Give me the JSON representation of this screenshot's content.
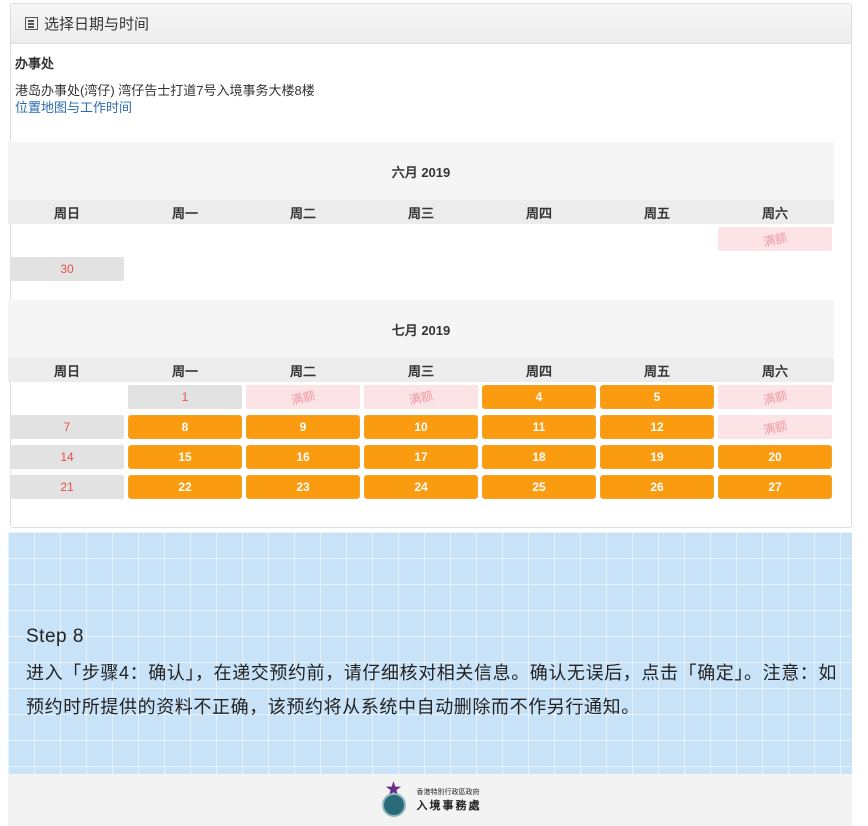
{
  "header": {
    "title": "选择日期与时间",
    "icon": "calendar-list-icon"
  },
  "office": {
    "label": "办事处",
    "address": "港岛办事处(湾仔) 湾仔告士打道7号入境事务大楼8楼",
    "link": "位置地图与工作时间"
  },
  "weekdays": [
    "周日",
    "周一",
    "周二",
    "周三",
    "周四",
    "周五",
    "周六"
  ],
  "months": [
    {
      "title": "六月 2019",
      "weeks": [
        [
          {
            "t": "",
            "s": "empty"
          },
          {
            "t": "",
            "s": "empty"
          },
          {
            "t": "",
            "s": "empty"
          },
          {
            "t": "",
            "s": "empty"
          },
          {
            "t": "",
            "s": "empty"
          },
          {
            "t": "",
            "s": "empty"
          },
          {
            "t": "满额",
            "s": "full"
          }
        ],
        [
          {
            "t": "30",
            "s": "sun"
          },
          {
            "t": "",
            "s": "empty"
          },
          {
            "t": "",
            "s": "empty"
          },
          {
            "t": "",
            "s": "empty"
          },
          {
            "t": "",
            "s": "empty"
          },
          {
            "t": "",
            "s": "empty"
          },
          {
            "t": "",
            "s": "empty"
          }
        ]
      ]
    },
    {
      "title": "七月 2019",
      "weeks": [
        [
          {
            "t": "",
            "s": "empty"
          },
          {
            "t": "1",
            "s": "past"
          },
          {
            "t": "满额",
            "s": "full"
          },
          {
            "t": "满额",
            "s": "full"
          },
          {
            "t": "4",
            "s": "avail"
          },
          {
            "t": "5",
            "s": "avail"
          },
          {
            "t": "满额",
            "s": "full"
          }
        ],
        [
          {
            "t": "7",
            "s": "sun"
          },
          {
            "t": "8",
            "s": "avail"
          },
          {
            "t": "9",
            "s": "avail"
          },
          {
            "t": "10",
            "s": "avail"
          },
          {
            "t": "11",
            "s": "avail"
          },
          {
            "t": "12",
            "s": "avail"
          },
          {
            "t": "满额",
            "s": "full"
          }
        ],
        [
          {
            "t": "14",
            "s": "sun"
          },
          {
            "t": "15",
            "s": "avail"
          },
          {
            "t": "16",
            "s": "avail"
          },
          {
            "t": "17",
            "s": "avail"
          },
          {
            "t": "18",
            "s": "avail"
          },
          {
            "t": "19",
            "s": "avail"
          },
          {
            "t": "20",
            "s": "avail"
          }
        ],
        [
          {
            "t": "21",
            "s": "sun"
          },
          {
            "t": "22",
            "s": "avail"
          },
          {
            "t": "23",
            "s": "avail"
          },
          {
            "t": "24",
            "s": "avail"
          },
          {
            "t": "25",
            "s": "avail"
          },
          {
            "t": "26",
            "s": "avail"
          },
          {
            "t": "27",
            "s": "avail"
          }
        ]
      ]
    }
  ],
  "step": {
    "title": "Step 8",
    "text": "进入「步骤4：确认」，在递交预约前，请仔细核对相关信息。确认无误后，点击「确定」。注意：如预约时所提供的资料不正确，该预约将从系统中自动删除而不作另行通知。"
  },
  "footer": {
    "line1": "香港特別行政區政府",
    "line2": "入境事務處",
    "emblem_icon": "immigration-department-emblem-icon"
  },
  "colors": {
    "available": "#fb9c10",
    "full": "#fbe3e6",
    "sunday_text": "#e8504b"
  }
}
